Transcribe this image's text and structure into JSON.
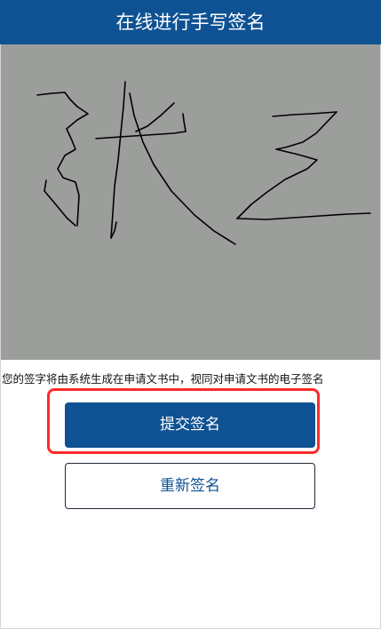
{
  "header": {
    "title": "在线进行手写签名"
  },
  "signature_pad": {
    "background": "#9c9e9c",
    "ink": "#000000"
  },
  "notice": {
    "text": "您的签字将由系统生成在申请文书中，视同对申请文书的电子签名"
  },
  "buttons": {
    "submit_label": "提交签名",
    "reset_label": "重新签名"
  },
  "colors": {
    "brand": "#0f5293",
    "highlight": "#ff2a2a"
  }
}
